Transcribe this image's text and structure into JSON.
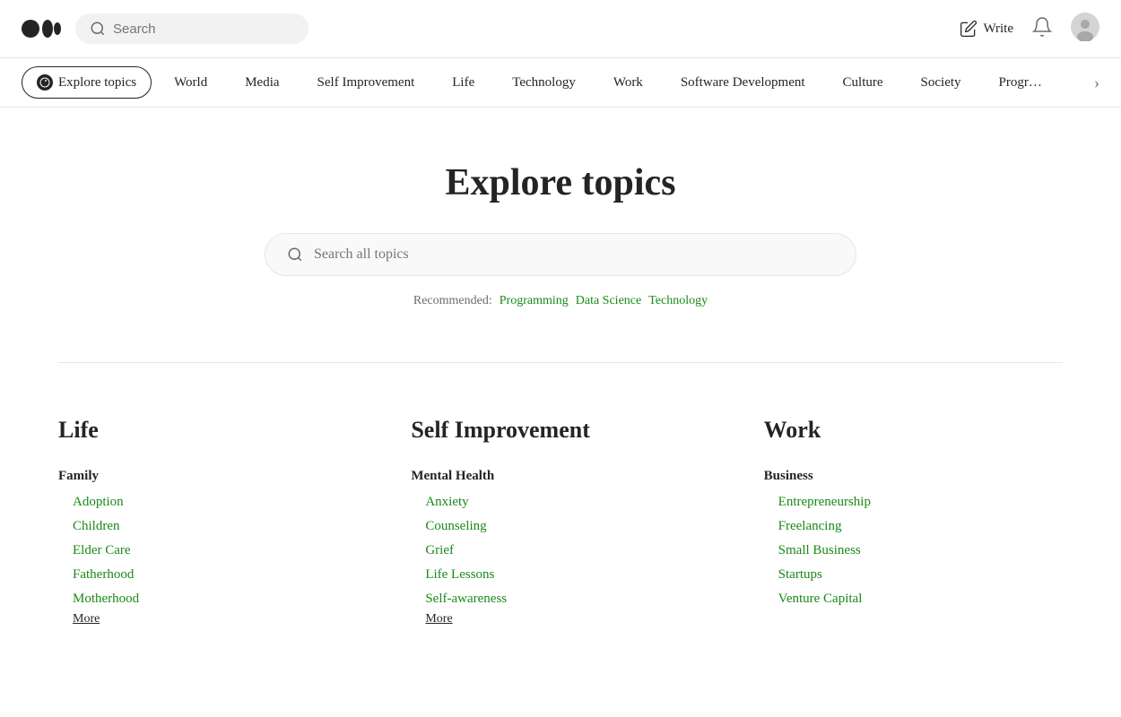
{
  "header": {
    "search_placeholder": "Search",
    "write_label": "Write",
    "logo_alt": "Medium logo"
  },
  "nav": {
    "active_item": "Explore topics",
    "items": [
      "Explore topics",
      "World",
      "Media",
      "Self Improvement",
      "Life",
      "Technology",
      "Work",
      "Software Development",
      "Culture",
      "Society",
      "Programming"
    ]
  },
  "hero": {
    "title": "Explore topics",
    "search_placeholder": "Search all topics",
    "recommended_label": "Recommended:",
    "recommended_links": [
      "Programming",
      "Data Science",
      "Technology"
    ]
  },
  "topics": [
    {
      "id": "life",
      "title": "Life",
      "subtopics": [
        {
          "group": "Family",
          "items": [
            "Adoption",
            "Children",
            "Elder Care",
            "Fatherhood",
            "Motherhood"
          ],
          "more": "More"
        }
      ]
    },
    {
      "id": "self-improvement",
      "title": "Self Improvement",
      "subtopics": [
        {
          "group": "Mental Health",
          "items": [
            "Anxiety",
            "Counseling",
            "Grief",
            "Life Lessons",
            "Self-awareness"
          ],
          "more": "More"
        }
      ]
    },
    {
      "id": "work",
      "title": "Work",
      "subtopics": [
        {
          "group": "Business",
          "items": [
            "Entrepreneurship",
            "Freelancing",
            "Small Business",
            "Startups",
            "Venture Capital"
          ],
          "more": null
        }
      ]
    }
  ]
}
